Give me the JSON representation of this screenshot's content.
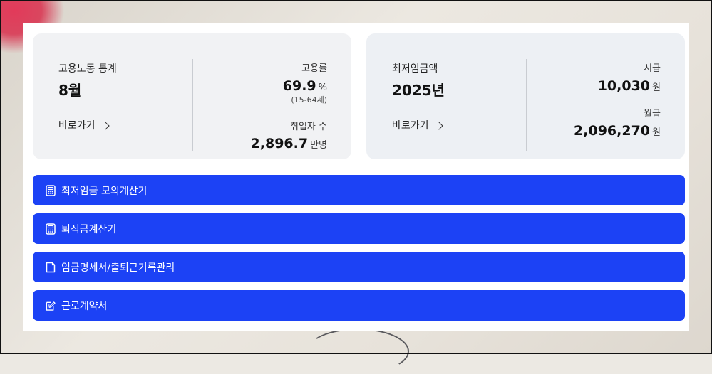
{
  "stats_card": {
    "title": "고용노동 통계",
    "month": "8월",
    "link_label": "바로가기",
    "employment_rate_label": "고용률",
    "employment_rate_value": "69.9",
    "employment_rate_unit": "%",
    "employment_rate_note": "(15-64세)",
    "employed_label": "취업자 수",
    "employed_value": "2,896.7",
    "employed_unit": "만명"
  },
  "wage_card": {
    "title": "최저임금액",
    "year": "2025년",
    "link_label": "바로가기",
    "hourly_label": "시급",
    "hourly_value": "10,030",
    "hourly_unit": "원",
    "monthly_label": "월급",
    "monthly_value": "2,096,270",
    "monthly_unit": "원"
  },
  "buttons": [
    {
      "label": "최저임금 모의계산기",
      "icon": "calculator-icon"
    },
    {
      "label": "퇴직금계산기",
      "icon": "calculator-icon"
    },
    {
      "label": "임금명세서/출퇴근기록관리",
      "icon": "document-icon"
    },
    {
      "label": "근로계약서",
      "icon": "edit-document-icon"
    }
  ],
  "colors": {
    "button_blue": "#1c42f5",
    "card_gray": "#f1f2f4",
    "card_blue_gray": "#edf0f4"
  }
}
